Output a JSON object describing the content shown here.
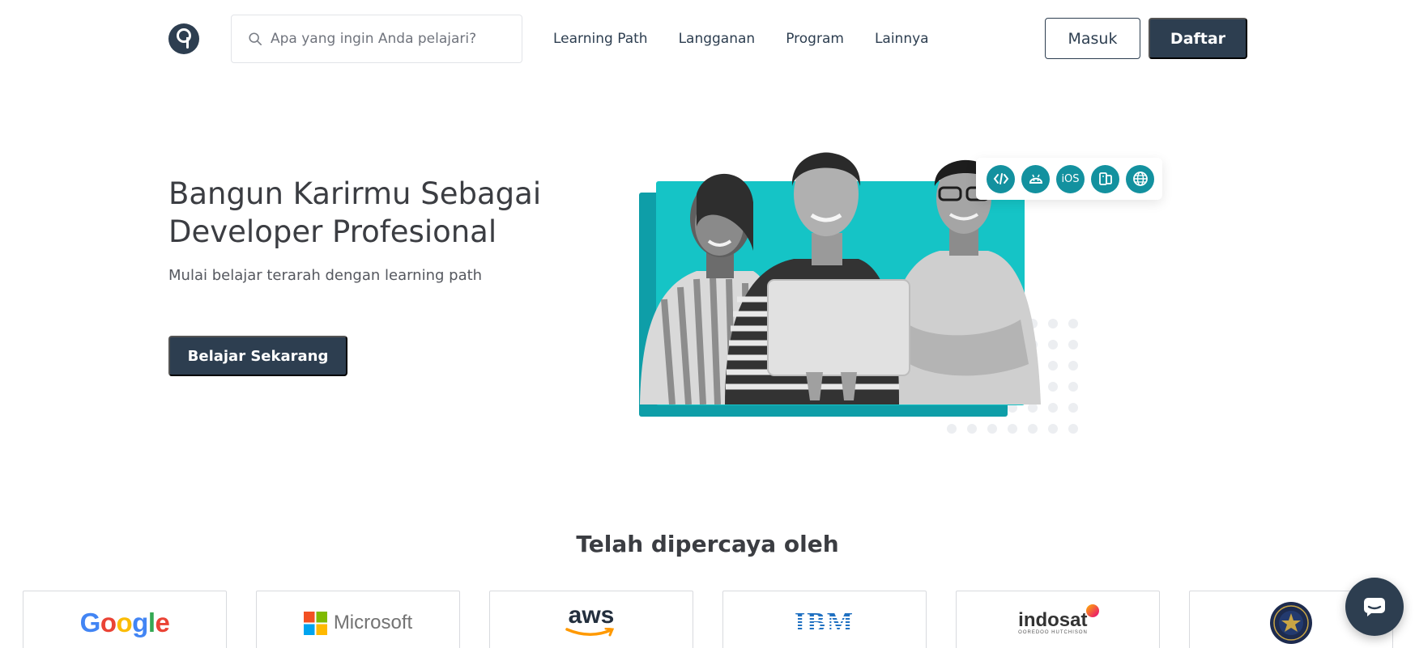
{
  "header": {
    "search_placeholder": "Apa yang ingin Anda pelajari?",
    "nav": [
      "Learning Path",
      "Langganan",
      "Program",
      "Lainnya"
    ],
    "login_label": "Masuk",
    "register_label": "Daftar"
  },
  "hero": {
    "title_line1": "Bangun Karirmu Sebagai",
    "title_line2": "Developer Profesional",
    "subtitle": "Mulai belajar terarah dengan learning path",
    "cta_label": "Belajar Sekarang",
    "tech_icons": [
      "code-icon",
      "android-icon",
      "ios-icon",
      "multiplatform-icon",
      "web-icon"
    ],
    "ios_text": "iOS"
  },
  "trusted": {
    "title": "Telah dipercaya oleh",
    "partners": [
      {
        "name": "Google"
      },
      {
        "name": "Microsoft"
      },
      {
        "name": "aws"
      },
      {
        "name": "IBM"
      },
      {
        "name": "indosat"
      },
      {
        "name": "government-seal"
      }
    ],
    "indosat_sub": "OOREDOO HUTCHISON"
  },
  "colors": {
    "primary": "#2d3e50",
    "teal": "#15c4c6",
    "teal_dark": "#0e9ea8",
    "tech_icon": "#13919f"
  }
}
